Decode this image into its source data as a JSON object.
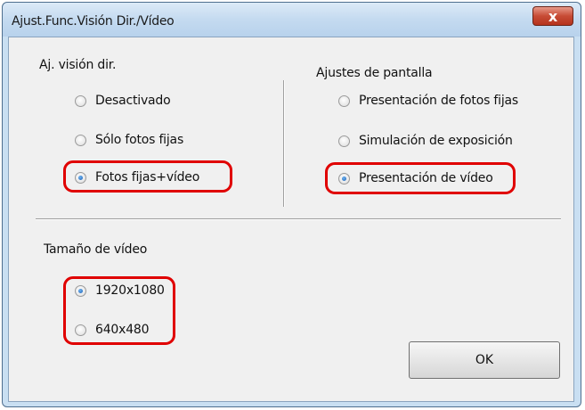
{
  "window": {
    "title": "Ajust.Func.Visión Dir./Vídeo",
    "close_glyph": "x"
  },
  "live_view": {
    "heading": "Aj. visión dir.",
    "options": [
      {
        "label": "Desactivado",
        "checked": false
      },
      {
        "label": "Sólo fotos fijas",
        "checked": false
      },
      {
        "label": "Fotos fijas+vídeo",
        "checked": true
      }
    ]
  },
  "screen_settings": {
    "heading": "Ajustes de pantalla",
    "options": [
      {
        "label": "Presentación de fotos fijas",
        "checked": false
      },
      {
        "label": "Simulación de exposición",
        "checked": false
      },
      {
        "label": "Presentación de vídeo",
        "checked": true
      }
    ]
  },
  "video_size": {
    "heading": "Tamaño de vídeo",
    "options": [
      {
        "label": "1920x1080",
        "checked": true
      },
      {
        "label": "640x480",
        "checked": false
      }
    ]
  },
  "ok_label": "OK",
  "colors": {
    "highlight": "#e00000",
    "titlebar": "#c4daf0",
    "client_bg": "#f0f0f0",
    "close_button": "#c74b35"
  }
}
